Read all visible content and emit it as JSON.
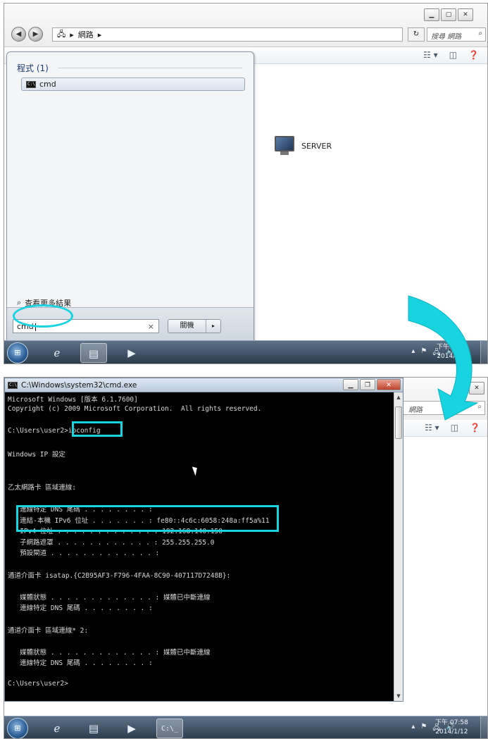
{
  "panel1": {
    "explorer": {
      "breadcrumb": [
        "網路"
      ],
      "search_placeholder": "搜尋 網路",
      "server_label": "SERVER"
    },
    "start_menu": {
      "section_header": "程式 (1)",
      "result_item": "cmd",
      "more_results": "查看更多結果",
      "search_value": "cmd",
      "clear_symbol": "×",
      "shutdown_label": "關機",
      "shutdown_arrow": "▸"
    },
    "taskbar": {
      "clock_time": "下午 07:5",
      "clock_date": "2014/1/1"
    }
  },
  "panel2": {
    "cmd_window": {
      "title": "C:\\Windows\\system32\\cmd.exe",
      "lines": [
        "Microsoft Windows [版本 6.1.7600]",
        "Copyright (c) 2009 Microsoft Corporation.  All rights reserved.",
        "",
        "C:\\Users\\user2>ipconfig",
        "",
        "Windows IP 設定",
        "",
        "",
        "乙太網路卡 區域連線:",
        "",
        "   連線特定 DNS 尾碼 . . . . . . . . :",
        "   連結-本機 IPv6 位址 . . . . . . . : fe80::4c6c:6058:248a:ff5a%11",
        "   IPv4 位址 . . . . . . . . . . . . : 192.168.140.150",
        "   子網路遮罩 . . . . . . . . . . . . : 255.255.255.0",
        "   預設閘道 . . . . . . . . . . . . . :",
        "",
        "通道介面卡 isatap.{C2B95AF3-F796-4FAA-8C90-407117D7248B}:",
        "",
        "   媒體狀態 . . . . . . . . . . . . . : 媒體已中斷連線",
        "   連線特定 DNS 尾碼 . . . . . . . . :",
        "",
        "通道介面卡 區域連線* 2:",
        "",
        "   媒體狀態 . . . . . . . . . . . . . : 媒體已中斷連線",
        "   連線特定 DNS 尾碼 . . . . . . . . :",
        "",
        "C:\\Users\\user2>"
      ]
    },
    "explorer_search_fragment": "網路",
    "taskbar": {
      "clock_time": "下午 07:58",
      "clock_date": "2014/1/12"
    }
  },
  "colors": {
    "highlight": "#18d3e0",
    "console_bg": "#000000",
    "console_text": "#d8d8d8",
    "taskbar_top": "#5d7288"
  }
}
